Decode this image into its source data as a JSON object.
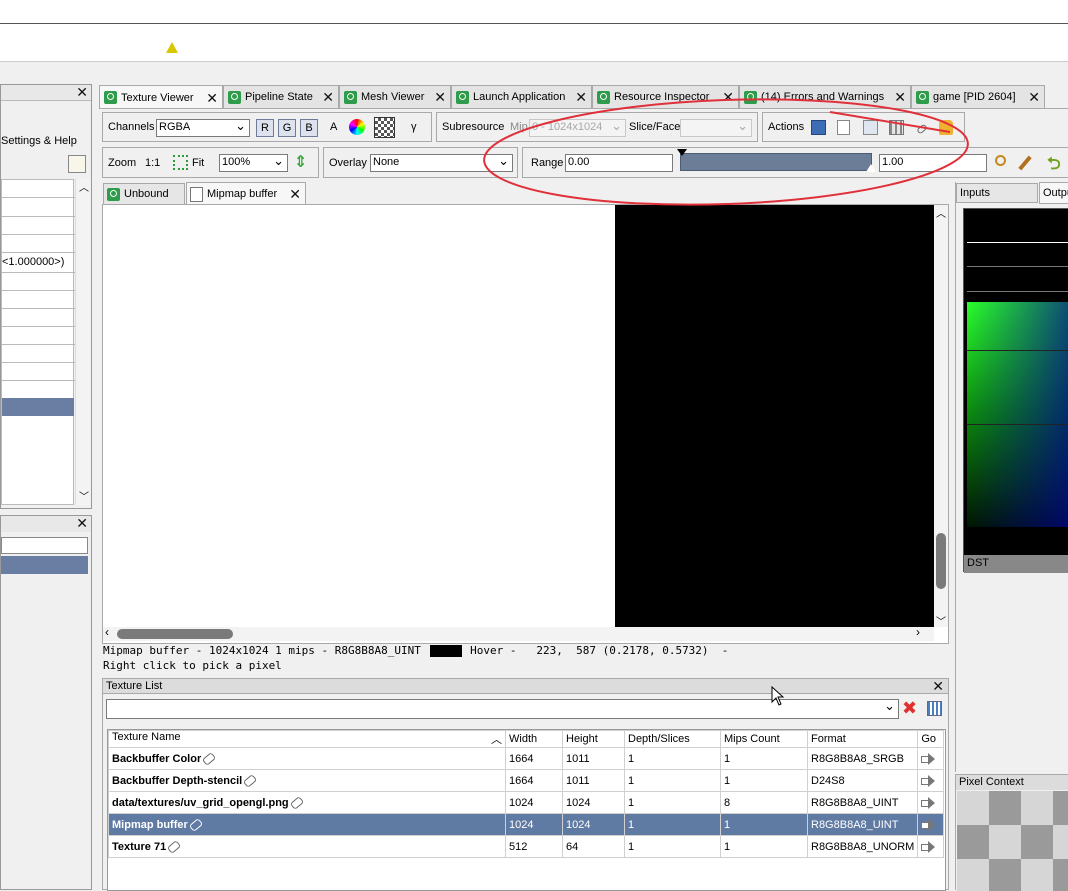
{
  "warning_icon": "warning-triangle-icon",
  "left_panel": {
    "settings_label": "Settings & Help",
    "vec_value": "<1.000000>)"
  },
  "tabs": [
    {
      "label": "Texture Viewer",
      "icon": "texture-icon"
    },
    {
      "label": "Pipeline State",
      "icon": "pipeline-icon"
    },
    {
      "label": "Mesh Viewer",
      "icon": "mesh-icon"
    },
    {
      "label": "Launch Application",
      "icon": "launch-icon"
    },
    {
      "label": "Resource Inspector",
      "icon": "inspector-icon"
    },
    {
      "label": "(14) Errors and Warnings",
      "icon": "warnings-icon"
    },
    {
      "label": "game [PID 2604]",
      "icon": "connection-icon"
    }
  ],
  "toolbar": {
    "channels_label": "Channels",
    "channels_value": "RGBA",
    "r": "R",
    "g": "G",
    "b": "B",
    "a": "A",
    "gamma": "γ",
    "subresource_label": "Subresource",
    "mip_label": "Mip",
    "mip_value": "0 - 1024x1024",
    "slice_label": "Slice/Face",
    "slice_value": "",
    "actions_label": "Actions",
    "zoom_label": "Zoom",
    "zoom_one": "1:1",
    "fit_label": "Fit",
    "zoom_value": "100%",
    "overlay_label": "Overlay",
    "overlay_value": "None",
    "range_label": "Range",
    "range_min": "0.00",
    "range_max": "1.00"
  },
  "subtabs": [
    {
      "label": "Unbound"
    },
    {
      "label": "Mipmap buffer"
    }
  ],
  "status": {
    "line1_left": "Mipmap buffer - 1024x1024 1 mips - R8G8B8A8_UINT",
    "line1_right": "Hover -   223,  587 (0.2178, 0.5732)  -",
    "line2": "Right click to pick a pixel",
    "swatch_color": "#000000"
  },
  "texture_list": {
    "title": "Texture List",
    "filter_value": "",
    "columns": [
      "Texture Name",
      "Width",
      "Height",
      "Depth/Slices",
      "Mips Count",
      "Format",
      "Go"
    ],
    "rows": [
      {
        "name": "Backbuffer Color",
        "width": "1664",
        "height": "1011",
        "depth": "1",
        "mips": "1",
        "format": "R8G8B8A8_SRGB",
        "selected": false
      },
      {
        "name": "Backbuffer Depth-stencil",
        "width": "1664",
        "height": "1011",
        "depth": "1",
        "mips": "1",
        "format": "D24S8",
        "selected": false
      },
      {
        "name": "data/textures/uv_grid_opengl.png",
        "width": "1024",
        "height": "1024",
        "depth": "1",
        "mips": "8",
        "format": "R8G8B8A8_UINT",
        "selected": false
      },
      {
        "name": "Mipmap buffer",
        "width": "1024",
        "height": "1024",
        "depth": "1",
        "mips": "1",
        "format": "R8G8B8A8_UINT",
        "selected": true
      },
      {
        "name": "Texture 71",
        "width": "512",
        "height": "64",
        "depth": "1",
        "mips": "1",
        "format": "R8G8B8A8_UNORM",
        "selected": false
      }
    ]
  },
  "right_panel": {
    "inputs_tab": "Inputs",
    "outputs_tab": "Outpu",
    "thumb_label": "DST",
    "pixel_context_title": "Pixel Context"
  },
  "colors": {
    "selection": "#5f7aa3",
    "annotation": "#e0303a",
    "range_bar": "#6c7d98"
  }
}
